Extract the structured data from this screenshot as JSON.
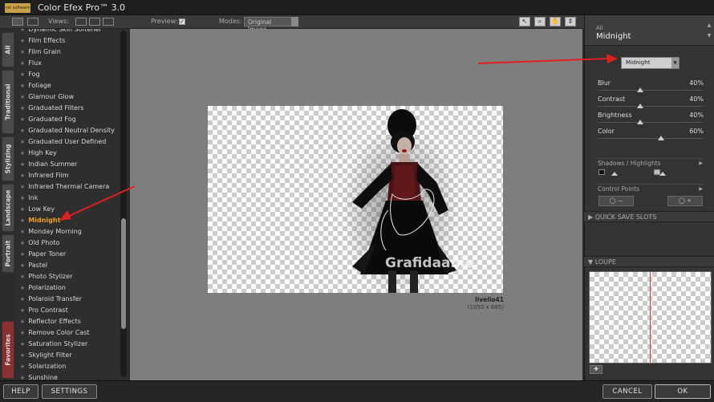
{
  "app": {
    "logo_text": "nik software",
    "title": "Color Efex Pro™ 3.0"
  },
  "toolbar": {
    "views_label": "Views:",
    "preview_label": "Preview:",
    "preview_checked": "✓",
    "modes_label": "Modes:",
    "modes_value": "Original Image",
    "tools": [
      "select-arrow-icon",
      "zoom-icon",
      "hand-icon",
      "pan-icon"
    ]
  },
  "category_tabs": [
    "All",
    "Traditional",
    "Stylizing",
    "Landscape",
    "Portrait",
    "Favorites"
  ],
  "filters": {
    "items": [
      "Dynamic Skin Softener",
      "Film Effects",
      "Film Grain",
      "Flux",
      "Fog",
      "Foliage",
      "Glamour Glow",
      "Graduated Filters",
      "Graduated Fog",
      "Graduated Neutral Density",
      "Graduated User Defined",
      "High Key",
      "Indian Summer",
      "Infrared Film",
      "Infrared Thermal Camera",
      "Ink",
      "Low Key",
      "Midnight",
      "Monday Morning",
      "Old Photo",
      "Paper Toner",
      "Pastel",
      "Photo Stylizer",
      "Polarization",
      "Polaroid Transfer",
      "Pro Contrast",
      "Reflector Effects",
      "Remove Color Cast",
      "Saturation Stylizer",
      "Skylight Filter",
      "Solarization",
      "Sunshine"
    ],
    "active_index": 17,
    "active_color": "#f0a020"
  },
  "canvas": {
    "watermark": "Grafidaanie",
    "image_name": "livello41",
    "image_size": "(1050 x 665)"
  },
  "panel": {
    "category": "All",
    "filter_name": "Midnight",
    "method_value": "Midnight",
    "sliders": [
      {
        "label": "Blur",
        "value": "40%",
        "level": 0.4
      },
      {
        "label": "Contrast",
        "value": "40%",
        "level": 0.4
      },
      {
        "label": "Brightness",
        "value": "40%",
        "level": 0.4
      },
      {
        "label": "Color",
        "value": "60%",
        "level": 0.6
      }
    ],
    "shadows_highlights": "Shadows / Highlights",
    "control_points": "Control Points",
    "quick_save": "QUICK SAVE SLOTS",
    "loupe": "LOUPE"
  },
  "bottom": {
    "help": "HELP",
    "settings": "SETTINGS",
    "cancel": "CANCEL",
    "ok": "OK"
  },
  "annotation_color": "#e02020"
}
